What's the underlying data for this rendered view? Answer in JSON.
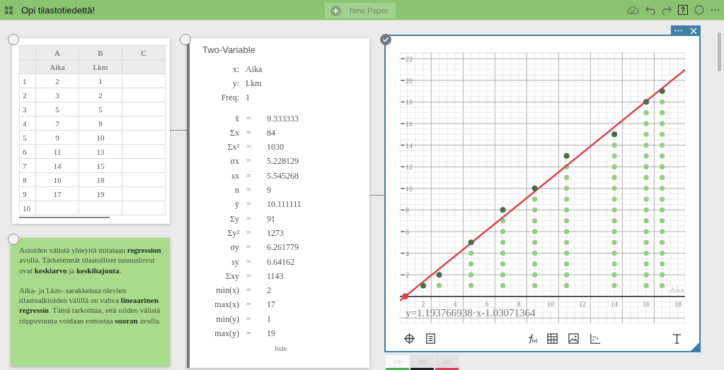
{
  "topbar": {
    "title": "Opi tilastotiedettä!",
    "new_paper": "New Paper",
    "help": "?"
  },
  "table_panel": {
    "checked": false,
    "columns": [
      "A",
      "B",
      "C"
    ],
    "names": [
      "Aika",
      "Lkm"
    ],
    "rows": [
      {
        "n": "1",
        "cells": [
          "2",
          "1"
        ]
      },
      {
        "n": "2",
        "cells": [
          "3",
          "2"
        ]
      },
      {
        "n": "3",
        "cells": [
          "5",
          "5"
        ]
      },
      {
        "n": "4",
        "cells": [
          "7",
          "8"
        ]
      },
      {
        "n": "5",
        "cells": [
          "9",
          "10"
        ]
      },
      {
        "n": "6",
        "cells": [
          "11",
          "13"
        ]
      },
      {
        "n": "7",
        "cells": [
          "14",
          "15"
        ]
      },
      {
        "n": "8",
        "cells": [
          "16",
          "18"
        ]
      },
      {
        "n": "9",
        "cells": [
          "17",
          "19"
        ]
      },
      {
        "n": "10",
        "cells": []
      }
    ]
  },
  "note_panel": {
    "checked": false,
    "paragraphs": [
      "Asioiden välistä yhteyttä mitataan **regression** avulla. Tärkeimmät tilastolliset tunnusluvut ovat **keskiarvo** ja **keskihajonta**.",
      "Aika- ja Lkm- sarakkeissa olevien tilastoalkioiden välillä on vahva **lineaarinen regressio**. Tämä tarkoittaa, että niiden välistä riippuvuutta voidaan ennustaa **suoran** avulla."
    ]
  },
  "stats_panel": {
    "checked": false,
    "title": "Two-Variable",
    "settings": [
      {
        "label": "x:",
        "value": "Aika"
      },
      {
        "label": "y:",
        "value": "Lkm"
      },
      {
        "label": "Freq:",
        "value": "1"
      }
    ],
    "results": [
      {
        "label": "x̄",
        "sign": "=",
        "value": "9.333333"
      },
      {
        "label": "Σx",
        "sign": "=",
        "value": "84"
      },
      {
        "label": "Σx²",
        "sign": "=",
        "value": "1030"
      },
      {
        "label": "σx",
        "sign": "=",
        "value": "5.228129"
      },
      {
        "label": "sx",
        "sign": "=",
        "value": "5.545268"
      },
      {
        "label": "n",
        "sign": "=",
        "value": "9"
      },
      {
        "label": "ȳ",
        "sign": "=",
        "value": "10.111111"
      },
      {
        "label": "Σy",
        "sign": "=",
        "value": "91"
      },
      {
        "label": "Σy²",
        "sign": "=",
        "value": "1273"
      },
      {
        "label": "σy",
        "sign": "=",
        "value": "6.261779"
      },
      {
        "label": "sy",
        "sign": "=",
        "value": "6.64162"
      },
      {
        "label": "Σxy",
        "sign": "=",
        "value": "1143"
      },
      {
        "label": "min(x)",
        "sign": "=",
        "value": "2"
      },
      {
        "label": "max(x)",
        "sign": "=",
        "value": "17"
      },
      {
        "label": "min(y)",
        "sign": "=",
        "value": "1"
      },
      {
        "label": "max(y)",
        "sign": "=",
        "value": "19"
      }
    ],
    "hide": "hide"
  },
  "graph_panel": {
    "checked": true,
    "equation": "y=1.193766938·x-1.03071364",
    "x_axis_label": "Aika",
    "chart_data": {
      "type": "scatter",
      "x": [
        2,
        3,
        5,
        7,
        9,
        11,
        14,
        16,
        17
      ],
      "series": [
        {
          "color": "#4e6b4e",
          "values": [
            1,
            2,
            5,
            8,
            10,
            13,
            15,
            18,
            19
          ]
        }
      ],
      "xlim": [
        0.53,
        18.44
      ],
      "ylim": [
        -2.5,
        22.6
      ],
      "xticks": [
        2,
        4,
        6,
        8,
        10,
        12,
        14,
        16,
        18
      ],
      "yticks": [
        2,
        4,
        6,
        8,
        10,
        12,
        14,
        16,
        18,
        20,
        22
      ],
      "grid": true
    }
  },
  "bottom_tabs": [
    {
      "selected": true,
      "color": "#4caf50"
    },
    {
      "selected": false,
      "color": "#222222"
    },
    {
      "selected": false,
      "color": "#d9434f"
    }
  ]
}
